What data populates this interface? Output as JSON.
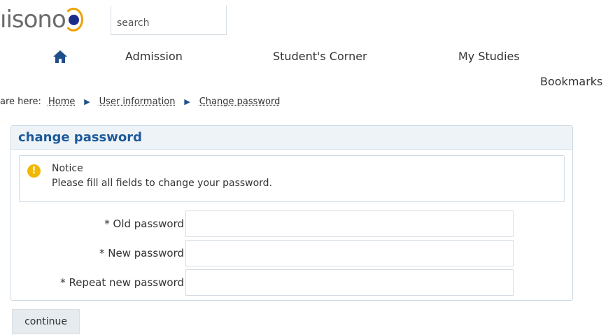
{
  "header": {
    "logo_text": "ıisono",
    "search": {
      "placeholder": "search",
      "value": ""
    }
  },
  "nav": {
    "home_icon": "home-icon",
    "items": [
      {
        "label": "Admission"
      },
      {
        "label": "Student's Corner"
      },
      {
        "label": "My Studies"
      }
    ],
    "bookmarks_label": "Bookmarks"
  },
  "breadcrumb": {
    "prefix": "are here:",
    "items": [
      {
        "label": "Home"
      },
      {
        "label": "User information"
      },
      {
        "label": "Change password"
      }
    ],
    "separator_icon": "chevron-right-icon"
  },
  "panel": {
    "title": "change password",
    "notice": {
      "icon": "info-icon",
      "title": "Notice",
      "text": "Please fill all fields to change your password."
    },
    "fields": [
      {
        "label": "* Old password",
        "value": ""
      },
      {
        "label": "* New password",
        "value": ""
      },
      {
        "label": "* Repeat new password",
        "value": ""
      }
    ]
  },
  "continue_label": "continue",
  "colors": {
    "accent": "#1d5a9a",
    "logo_dot": "#1d2c86",
    "logo_arc": "#f0a000",
    "notice_icon": "#f2b800",
    "panel_header_bg": "#eef3f7"
  }
}
